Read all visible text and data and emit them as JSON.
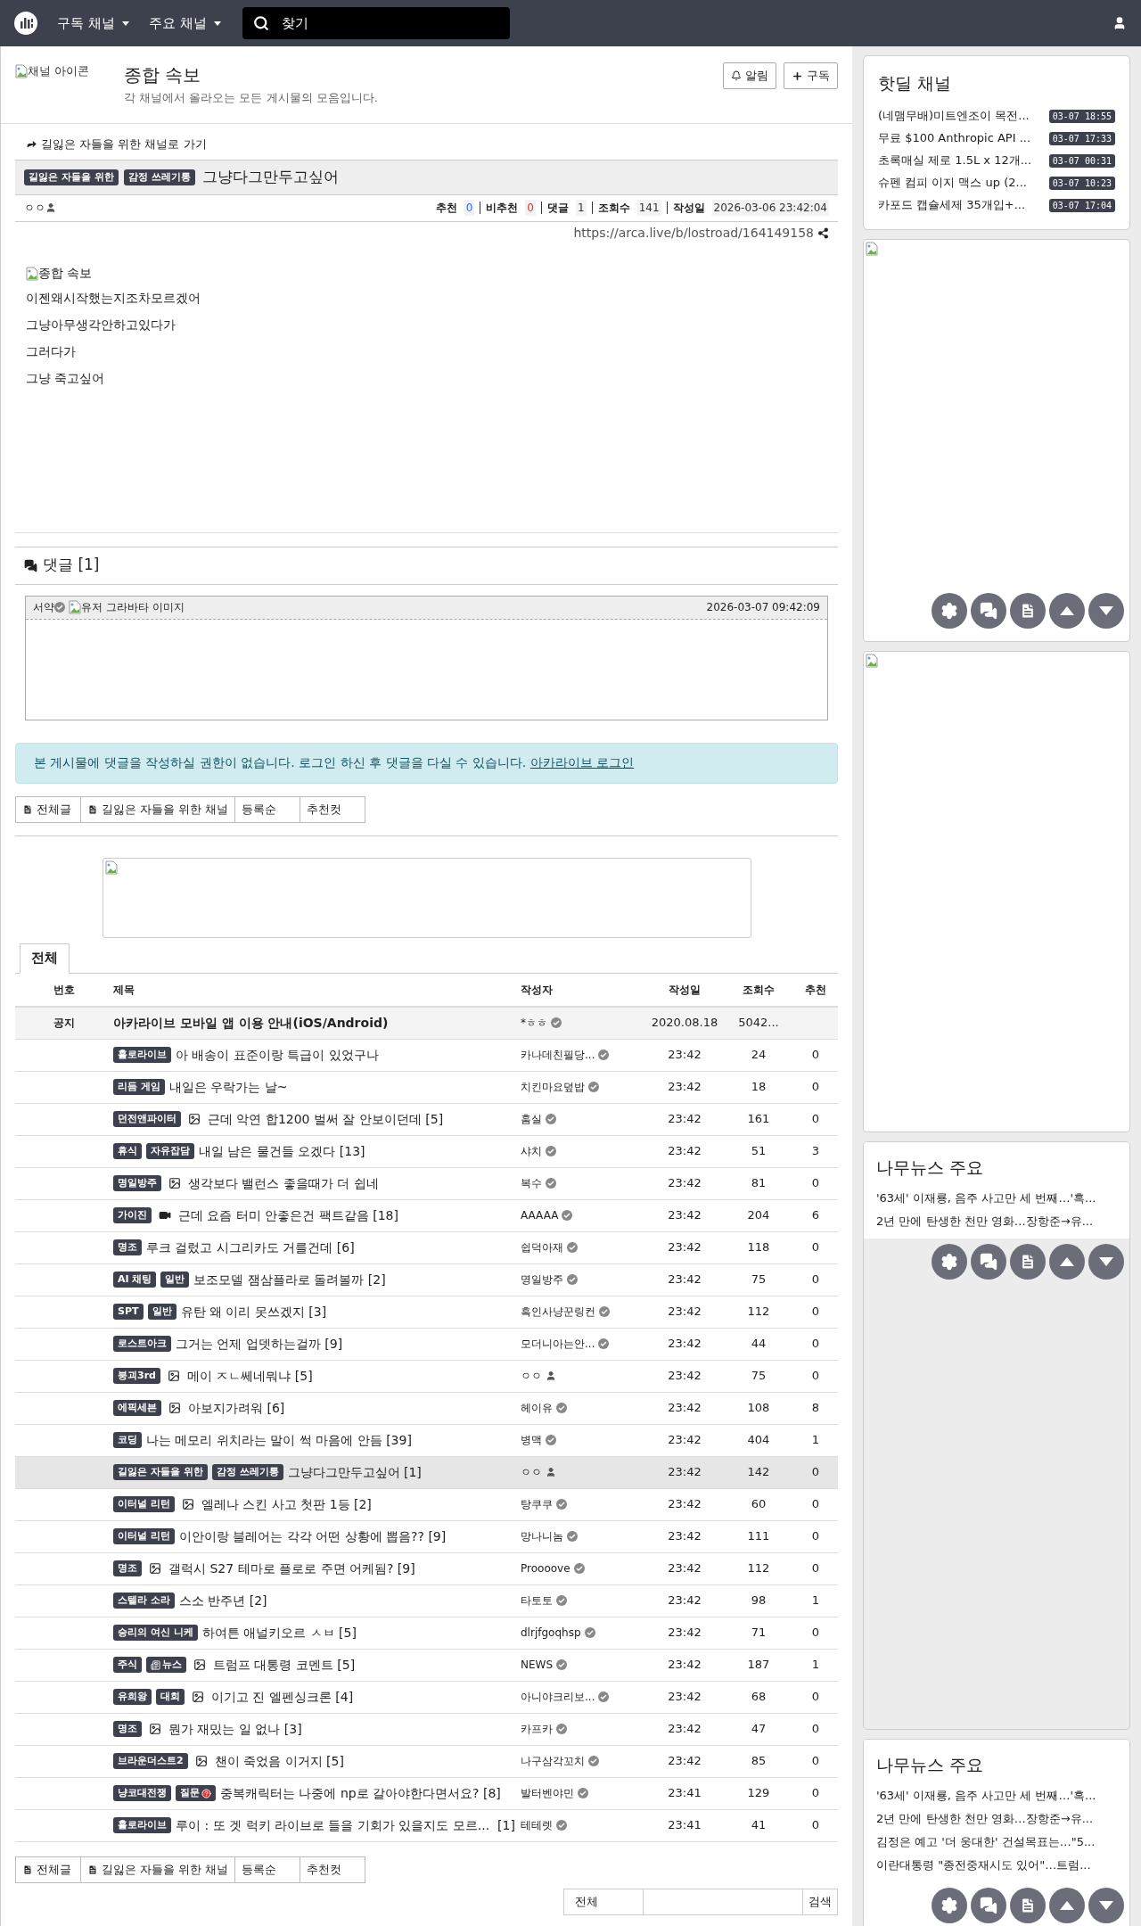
{
  "nav": {
    "menus": [
      "구독 채널",
      "주요 채널"
    ],
    "search_placeholder": "찾기"
  },
  "channel": {
    "icon_alt": "채널 아이콘",
    "title": "종합 속보",
    "description": "각 채널에서 올라오는 모든 게시물의 모음입니다.",
    "buttons": [
      "알림",
      "구독"
    ]
  },
  "post": {
    "channel_link": "길잃은 자들을 위한 채널로 가기",
    "badges": [
      "길잃은 자들을 위한",
      "감정 쓰레기통"
    ],
    "title": "그냥다그만두고싶어",
    "author": "ㅇㅇ",
    "author_verified": false,
    "stats": [
      {
        "label": "추천",
        "value": "0",
        "kind": "up"
      },
      {
        "label": "비추천",
        "value": "0",
        "kind": "down"
      },
      {
        "label": "댓글",
        "value": "1",
        "kind": "plain"
      },
      {
        "label": "조회수",
        "value": "141",
        "kind": "plain"
      },
      {
        "label": "작성일",
        "value": "2026-03-06 23:42:04",
        "kind": "plain"
      }
    ],
    "url": "https://arca.live/b/lostroad/164149158",
    "image_alt": "종합 속보",
    "lines": [
      "이젠왜시작했는지조차모르겠어",
      "그냥아무생각안하고있다가",
      "그러다가",
      "그냥 죽고싶어"
    ]
  },
  "comments": {
    "heading": "댓글 [1]",
    "items": [
      {
        "author": "서약",
        "author_verified": true,
        "avatar_alt": "유저 그라바타 이미지",
        "date": "2026-03-07 09:42:09"
      }
    ]
  },
  "login_notice": {
    "text": "본 게시물에 댓글을 작성하실 권한이 없습니다. 로그인 하신 후 댓글을 다실 수 있습니다.",
    "link": "아카라이브 로그인"
  },
  "list_buttons_top": [
    "전체글",
    "길잃은 자들을 위한 채널",
    "등록순",
    "추천컷"
  ],
  "tabs": [
    {
      "label": "전체",
      "selected": true
    }
  ],
  "table": {
    "columns": [
      "번호",
      "제목",
      "작성자",
      "작성일",
      "조회수",
      "추천"
    ],
    "rows": [
      {
        "kind": "notice",
        "number": "공지",
        "title": "아카라이브 모바일 앱 이용 안내(iOS/Android)",
        "author": "*ㅎㅎ",
        "verified": true,
        "date": "2020.08.18",
        "views": "5042...",
        "selected": false
      },
      {
        "kind": "post",
        "badges": [
          {
            "text": "홀로라이브"
          }
        ],
        "title": "아 배송이 표준이랑 특급이 있었구나",
        "author": "카나데친필당...",
        "verified": true,
        "date": "23:42",
        "views": "24",
        "likes": "0",
        "selected": false
      },
      {
        "kind": "post",
        "badges": [
          {
            "text": "리듬 게임"
          }
        ],
        "title": "내일은 우락가는 날~",
        "author": "치킨마요덮밥",
        "verified": true,
        "date": "23:42",
        "views": "18",
        "likes": "0",
        "selected": false
      },
      {
        "kind": "post",
        "badges": [
          {
            "text": "던전앤파이터"
          }
        ],
        "has_image": true,
        "title": "근데 악연 합1200 벌써 잘 안보이던데 [5]",
        "author": "훔실",
        "verified": true,
        "date": "23:42",
        "views": "161",
        "likes": "0",
        "selected": false
      },
      {
        "kind": "post",
        "badges": [
          {
            "text": "휴식"
          },
          {
            "text": "자유잡담"
          }
        ],
        "title": "내일 남은 물건들 오겠다 [13]",
        "author": "샤치",
        "verified": true,
        "date": "23:42",
        "views": "51",
        "likes": "3",
        "selected": false
      },
      {
        "kind": "post",
        "badges": [
          {
            "text": "명일방주"
          }
        ],
        "has_image": true,
        "title": "생각보다 밸런스 좋을때가 더 쉽네",
        "author": "복수",
        "verified": true,
        "date": "23:42",
        "views": "81",
        "likes": "0",
        "selected": false
      },
      {
        "kind": "post",
        "badges": [
          {
            "text": "가이진"
          }
        ],
        "has_video": true,
        "title": "근데 요즘 터미 안좋은건 팩트같음 [18]",
        "author": "AAAAA",
        "verified": true,
        "date": "23:42",
        "views": "204",
        "likes": "6",
        "selected": false
      },
      {
        "kind": "post",
        "badges": [
          {
            "text": "명조"
          }
        ],
        "title": "루크 걸렀고 시그리카도 거를건데 [6]",
        "author": "쉽덕아재",
        "verified": true,
        "date": "23:42",
        "views": "118",
        "likes": "0",
        "selected": false
      },
      {
        "kind": "post",
        "badges": [
          {
            "text": "AI 채팅"
          },
          {
            "text": "일반"
          }
        ],
        "title": "보조모델 잼삼플라로 돌려볼까 [2]",
        "author": "명일방주",
        "verified": true,
        "date": "23:42",
        "views": "75",
        "likes": "0",
        "selected": false
      },
      {
        "kind": "post",
        "badges": [
          {
            "text": "SPT"
          },
          {
            "text": "일반"
          }
        ],
        "title": "유탄 왜 이리 못쓰겠지 [3]",
        "author": "흑인사냥꾼링컨",
        "verified": true,
        "date": "23:42",
        "views": "112",
        "likes": "0",
        "selected": false
      },
      {
        "kind": "post",
        "badges": [
          {
            "text": "로스트아크"
          }
        ],
        "title": "그거는 언제 업뎃하는걸까 [9]",
        "author": "모더니아는안...",
        "verified": true,
        "date": "23:42",
        "views": "44",
        "likes": "0",
        "selected": false
      },
      {
        "kind": "post",
        "badges": [
          {
            "text": "붕괴3rd"
          }
        ],
        "has_image": true,
        "title": "메이 ㅈㄴ쎄네뭐냐 [5]",
        "author": "ㅇㅇ",
        "verified": false,
        "date": "23:42",
        "views": "75",
        "likes": "0",
        "selected": false
      },
      {
        "kind": "post",
        "badges": [
          {
            "text": "에픽세븐"
          }
        ],
        "has_image": true,
        "title": "아보지가려워 [6]",
        "author": "헤이유",
        "verified": true,
        "date": "23:42",
        "views": "108",
        "likes": "8",
        "selected": false
      },
      {
        "kind": "post",
        "badges": [
          {
            "text": "코딩"
          }
        ],
        "title": "나는 메모리 위치라는 말이 썩 마음에 안듬 [39]",
        "author": "병맥",
        "verified": true,
        "date": "23:42",
        "views": "404",
        "likes": "1",
        "selected": false
      },
      {
        "kind": "post",
        "badges": [
          {
            "text": "길잃은 자들을 위한"
          },
          {
            "text": "감정 쓰레기통"
          }
        ],
        "title": "그냥다그만두고싶어 [1]",
        "author": "ㅇㅇ",
        "verified": false,
        "date": "23:42",
        "views": "142",
        "likes": "0",
        "selected": true
      },
      {
        "kind": "post",
        "badges": [
          {
            "text": "이터널 리턴"
          }
        ],
        "has_image": true,
        "title": "엘레나 스킨 사고 첫판 1등 [2]",
        "author": "탕쿠쿠",
        "verified": true,
        "date": "23:42",
        "views": "60",
        "likes": "0",
        "selected": false
      },
      {
        "kind": "post",
        "badges": [
          {
            "text": "이터널 리턴"
          }
        ],
        "title": "이안이랑 블레어는 각각 어떤 상황에 뽑음?? [9]",
        "author": "망나니놈",
        "verified": true,
        "date": "23:42",
        "views": "111",
        "likes": "0",
        "selected": false
      },
      {
        "kind": "post",
        "badges": [
          {
            "text": "명조"
          }
        ],
        "has_image": true,
        "title": "갤럭시 S27 테마로 플로로 주면 어케됨? [9]",
        "author": "Proooove",
        "verified": true,
        "date": "23:42",
        "views": "112",
        "likes": "0",
        "selected": false
      },
      {
        "kind": "post",
        "badges": [
          {
            "text": "스텔라 소라"
          }
        ],
        "title": "스소 반주년 [2]",
        "author": "타토토",
        "verified": true,
        "date": "23:42",
        "views": "98",
        "likes": "1",
        "selected": false
      },
      {
        "kind": "post",
        "badges": [
          {
            "text": "승리의 여신 니케"
          }
        ],
        "title": "하여튼 애널키오르 ㅅㅂ [5]",
        "author": "dlrjfgoqhsp",
        "verified": true,
        "date": "23:42",
        "views": "71",
        "likes": "0",
        "selected": false
      },
      {
        "kind": "post",
        "badges": [
          {
            "text": "주식",
            "kind": "plain"
          },
          {
            "text": "뉴스",
            "kind": "news"
          }
        ],
        "has_image": true,
        "title": "트럼프 대통령 코멘트 [5]",
        "author": "NEWS",
        "verified": true,
        "date": "23:42",
        "views": "187",
        "likes": "1",
        "selected": false
      },
      {
        "kind": "post",
        "badges": [
          {
            "text": "유희왕"
          },
          {
            "text": "대회"
          }
        ],
        "has_image": true,
        "title": "이기고 진 엘펜싱크론 [4]",
        "author": "아니야크리보...",
        "verified": true,
        "date": "23:42",
        "views": "68",
        "likes": "0",
        "selected": false
      },
      {
        "kind": "post",
        "badges": [
          {
            "text": "명조"
          }
        ],
        "has_image": true,
        "title": "뭔가 재밌는 일 없나 [3]",
        "author": "카프카",
        "verified": true,
        "date": "23:42",
        "views": "47",
        "likes": "0",
        "selected": false
      },
      {
        "kind": "post",
        "badges": [
          {
            "text": "브라운더스트2"
          }
        ],
        "has_image": true,
        "title": "챈이 죽었음 이거지 [5]",
        "author": "나구삼각꼬치",
        "verified": true,
        "date": "23:42",
        "views": "85",
        "likes": "0",
        "selected": false
      },
      {
        "kind": "post",
        "badges": [
          {
            "text": "냥코대전쟁",
            "kind": "plain"
          },
          {
            "text": "질문",
            "kind": "question"
          }
        ],
        "title": "중복캐릭터는 나중에 np로 갈아야한다면서요? [8]",
        "author": "발터벤야민",
        "verified": true,
        "date": "23:41",
        "views": "129",
        "likes": "0",
        "selected": false
      },
      {
        "kind": "post",
        "badges": [
          {
            "text": "홀로라이브"
          }
        ],
        "title": "루이 : 또 겟 럭키 라이브로 들을 기회가 있을지도 모르...  [1]",
        "author": "테테렛",
        "verified": true,
        "date": "23:41",
        "views": "41",
        "likes": "0",
        "selected": false
      }
    ]
  },
  "list_buttons_bottom": [
    "전체글",
    "길잃은 자들을 위한 채널",
    "등록순",
    "추천컷"
  ],
  "search": {
    "scope": "전체",
    "button": "검색"
  },
  "sidebar": {
    "hotdeal": {
      "title": "핫딜 채널",
      "items": [
        {
          "title": "(네맴무배)미트엔조이 목전...",
          "time": "03-07 18:55"
        },
        {
          "title": "무료 $100 Anthropic API ...",
          "time": "03-07 17:33"
        },
        {
          "title": "초록매실 제로 1.5L x 12개...",
          "time": "03-07 00:31"
        },
        {
          "title": "슈펜 컴피 이지 맥스 up (2...",
          "time": "03-07 10:23"
        },
        {
          "title": "카포드 캡슐세제 35개입+...",
          "time": "03-07 17:04"
        }
      ]
    },
    "news": [
      {
        "title": "나무뉴스 주요",
        "items": [
          "'63세' 이재룡, 음주 사고만 세 번째…'흑...",
          "2년 만에 탄생한 천만 영화…장항준→유..."
        ]
      },
      {
        "title": "나무뉴스 주요",
        "items": [
          "'63세' 이재룡, 음주 사고만 세 번째…'흑...",
          "2년 만에 탄생한 천만 영화…장항준→유...",
          "김정은 예고 '더 웅대한' 건설목표는…\"5...",
          "이란대통령 \"종전중재시도 있어\"…트럼..."
        ]
      }
    ]
  }
}
